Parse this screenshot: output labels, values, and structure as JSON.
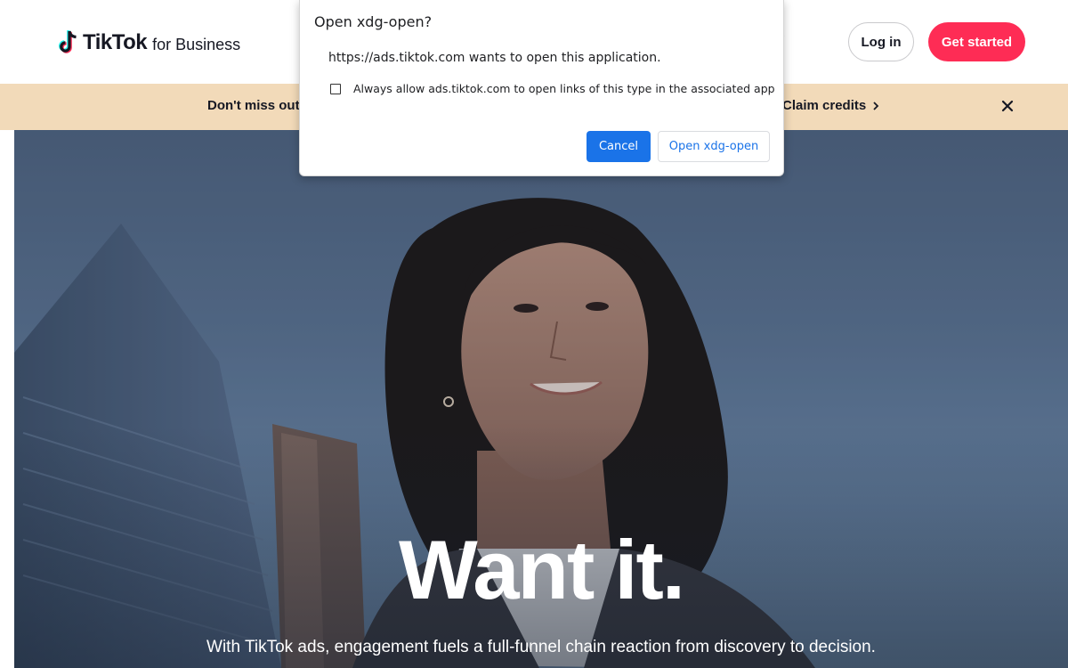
{
  "header": {
    "logo_word": "TikTok",
    "logo_sub": "for Business",
    "nav_fragment": "ᐯ",
    "login_label": "Log in",
    "start_label": "Get started"
  },
  "banner": {
    "text": "Don't miss out o",
    "cta_label": "Claim credits",
    "cta_icon": "chevron-right-icon",
    "close_icon": "close-icon"
  },
  "hero": {
    "title": "Want it.",
    "subtitle": "With TikTok ads, engagement fuels a full-funnel chain reaction from discovery to decision."
  },
  "dialog": {
    "title": "Open xdg-open?",
    "message": "https://ads.tiktok.com wants to open this application.",
    "checkbox_label": "Always allow ads.tiktok.com to open links of this type in the associated app",
    "checkbox_checked": false,
    "cancel_label": "Cancel",
    "open_label": "Open xdg-open"
  },
  "colors": {
    "brand_red": "#fe2c55",
    "banner_bg": "#f2dab9",
    "dialog_primary": "#1a73e8"
  }
}
